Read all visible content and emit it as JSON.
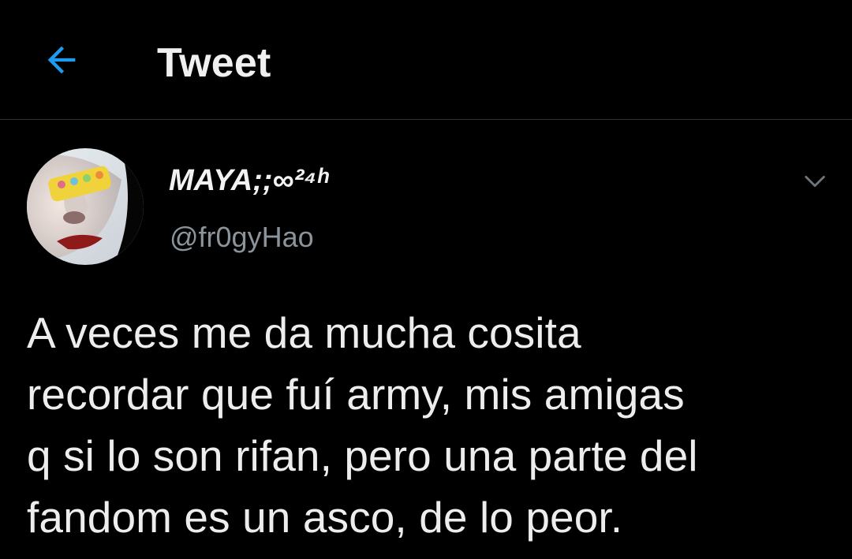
{
  "header": {
    "back_icon": "arrow-left-icon",
    "title": "Tweet",
    "accent_color": "#1d9bf0"
  },
  "tweet": {
    "author": {
      "display_name": "MAYA;;∞²⁴ʰ",
      "handle": "@fr0gyHao",
      "avatar_icon": "profile-photo"
    },
    "menu_icon": "chevron-down-icon",
    "text": "A veces me da mucha cosita\nrecordar que fuí army, mis amigas\nq si lo son rifan, pero una parte del\nfandom es un asco, de lo peor."
  }
}
